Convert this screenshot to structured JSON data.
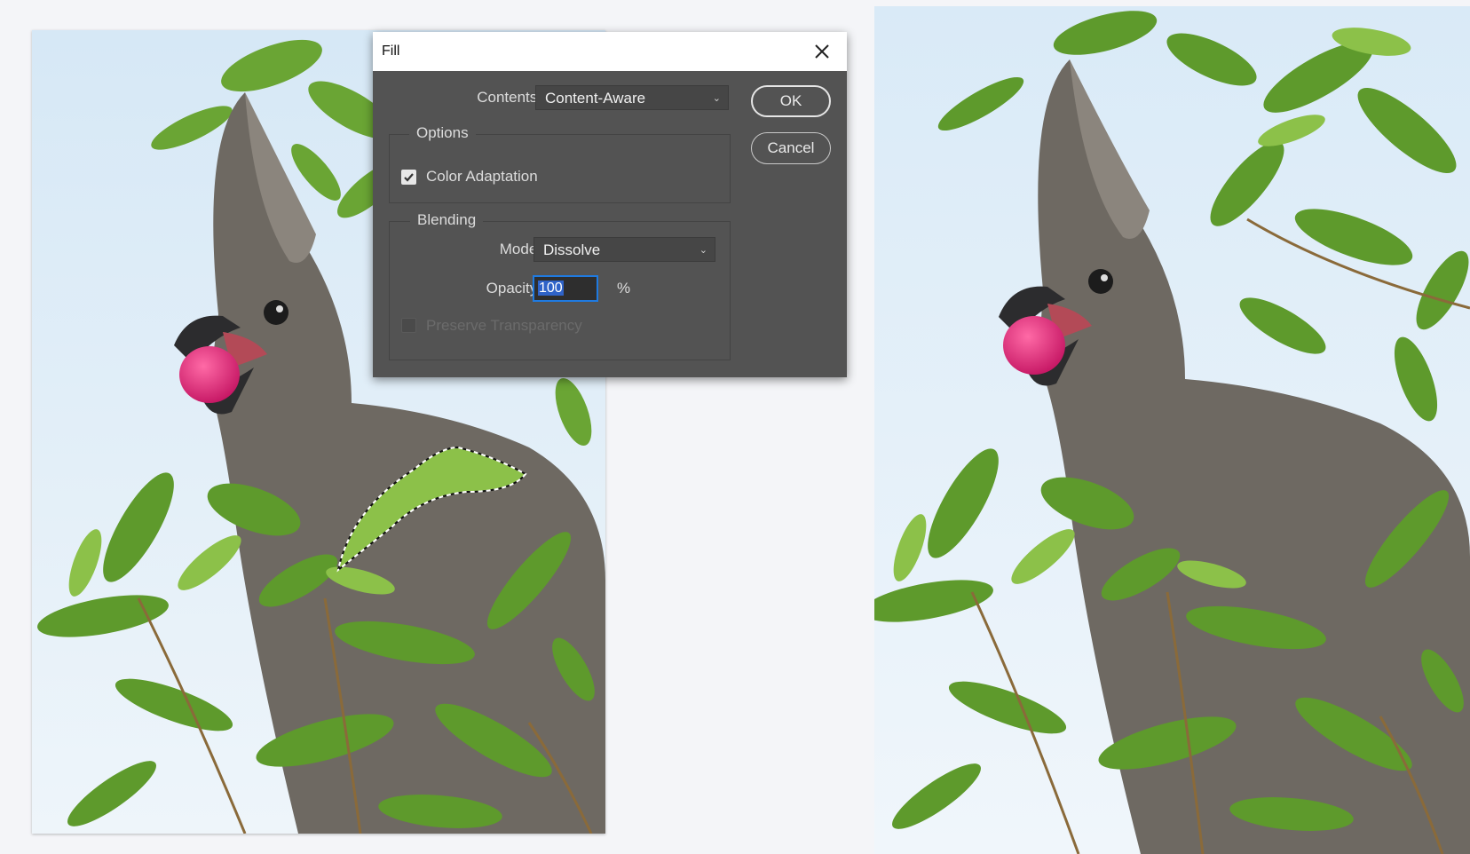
{
  "dialog": {
    "title": "Fill",
    "contents_label": "Contents:",
    "contents_value": "Content-Aware",
    "ok_label": "OK",
    "cancel_label": "Cancel",
    "options": {
      "legend": "Options",
      "color_adaptation_label": "Color Adaptation",
      "color_adaptation_checked": true
    },
    "blending": {
      "legend": "Blending",
      "mode_label": "Mode:",
      "mode_value": "Dissolve",
      "opacity_label": "Opacity:",
      "opacity_value": "100",
      "opacity_unit": "%",
      "preserve_transparency_label": "Preserve Transparency",
      "preserve_transparency_checked": false,
      "preserve_transparency_enabled": false
    }
  },
  "colors": {
    "dialog_bg": "#535353",
    "sky": "#dceaf3",
    "bird": "#6f6a63",
    "berry": "#e0236e",
    "leaf": "#5e9a2c"
  }
}
